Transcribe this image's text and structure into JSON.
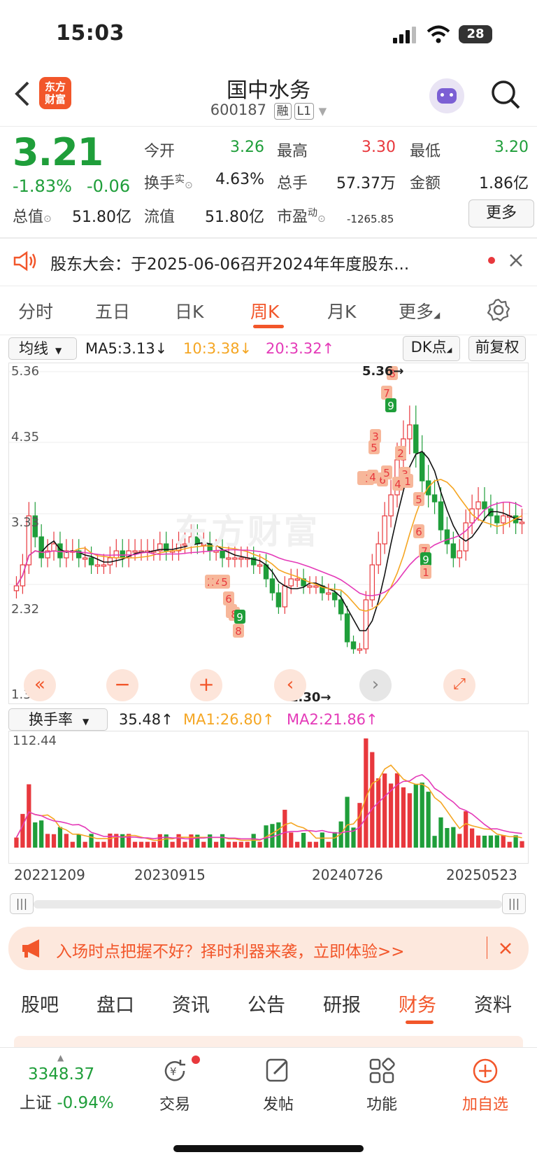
{
  "status": {
    "time": "15:03",
    "battery": "28"
  },
  "header": {
    "title": "国中水务",
    "code": "600187",
    "tag1": "融",
    "tag2": "L1",
    "logo_line1": "东方",
    "logo_line2": "财富"
  },
  "quote": {
    "price": "3.21",
    "pct": "-1.83%",
    "change": "-0.06",
    "open_label": "今开",
    "open": "3.26",
    "high_label": "最高",
    "high": "3.30",
    "low_label": "最低",
    "low": "3.20",
    "turnover_label": "换手",
    "turnover_sup": "实",
    "turnover": "4.63%",
    "volume_label": "总手",
    "volume": "57.37万",
    "amount_label": "金额",
    "amount": "1.86亿",
    "mktcap_label": "总值",
    "mktcap": "51.80亿",
    "float_label": "流值",
    "float": "51.80亿",
    "pe_label": "市盈",
    "pe_sup": "动",
    "pe": "-1265.85",
    "more": "更多"
  },
  "notice": {
    "text": "股东大会：于2025-06-06召开2024年年度股东..."
  },
  "period_tabs": [
    "分时",
    "五日",
    "日K",
    "周K",
    "月K",
    "更多"
  ],
  "chart_toolbar": {
    "indicator": "均线",
    "ma5": "MA5:3.13↓",
    "ma10": "10:3.38↓",
    "ma20": "20:3.32↑",
    "dk": "DK点",
    "adjust": "前复权"
  },
  "vol_toolbar": {
    "indicator": "换手率",
    "val": "35.48↑",
    "ma1": "MA1:26.80↑",
    "ma2": "MA2:21.86↑"
  },
  "chart_data": [
    {
      "type": "candlestick",
      "y_ticks": [
        "5.36",
        "4.35",
        "3.33",
        "2.32",
        "1.30"
      ],
      "max_label": "5.36→",
      "min_label": "1.30→",
      "watermark": "东方财富",
      "signal_labels": [
        "8",
        "7",
        "9",
        "3",
        "5",
        "2",
        "3",
        "1",
        "4",
        "5",
        "6",
        "7",
        "9",
        "1",
        "2",
        "3",
        "4",
        "5",
        "6",
        "7",
        "8",
        "9",
        "8",
        "1",
        "2",
        "3",
        "4",
        "6",
        "5"
      ],
      "close_series": [
        2.3,
        2.6,
        3.3,
        3.0,
        2.7,
        2.8,
        2.9,
        2.7,
        2.8,
        2.8,
        2.7,
        2.7,
        2.6,
        2.6,
        2.6,
        2.7,
        2.8,
        2.7,
        2.8,
        2.8,
        2.8,
        2.8,
        2.8,
        2.9,
        2.8,
        2.8,
        2.9,
        2.9,
        3.0,
        2.9,
        2.9,
        2.8,
        2.8,
        2.7,
        2.7,
        2.7,
        2.7,
        2.7,
        2.6,
        2.6,
        2.4,
        2.2,
        2.0,
        2.3,
        2.4,
        2.4,
        2.3,
        2.3,
        2.3,
        2.2,
        2.2,
        2.1,
        1.9,
        1.5,
        1.4,
        1.4,
        2.1,
        2.6,
        2.9,
        3.3,
        3.6,
        4.1,
        4.4,
        4.6,
        4.2,
        3.8,
        3.6,
        3.5,
        3.1,
        2.9,
        2.7,
        2.8,
        3.2,
        3.4,
        3.5,
        3.4,
        3.3,
        3.2,
        3.3,
        3.3,
        3.2,
        3.21
      ]
    },
    {
      "type": "bar",
      "y_ticks": [
        "112.44"
      ],
      "x_labels": [
        "20221209",
        "20230915",
        "20240726",
        "20250523"
      ]
    }
  ],
  "banner": {
    "text": "入场时点把握不好？择时利器来袭，立即体验>>"
  },
  "bottom_tabs": [
    "股吧",
    "盘口",
    "资讯",
    "公告",
    "研报",
    "财务",
    "资料"
  ],
  "tabbar": {
    "index_value": "3348.37",
    "index_name": "上证",
    "index_pct": "-0.94%",
    "trade": "交易",
    "post": "发帖",
    "func": "功能",
    "add": "加自选"
  }
}
